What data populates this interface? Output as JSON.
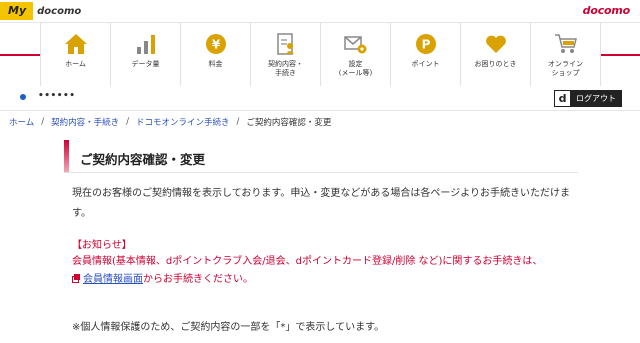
{
  "header": {
    "my_label": "My",
    "my_brand": "docomo",
    "brand": "docomo"
  },
  "nav": {
    "items": [
      {
        "label": "ホーム",
        "icon": "home-icon"
      },
      {
        "label": "データ量",
        "icon": "bar-chart-icon"
      },
      {
        "label": "料金",
        "icon": "yen-icon"
      },
      {
        "label": "契約内容・\n手続き",
        "icon": "contract-document-icon"
      },
      {
        "label": "設定\n(メール等)",
        "icon": "mail-settings-icon"
      },
      {
        "label": "ポイント",
        "icon": "point-icon"
      },
      {
        "label": "お困りのとき",
        "icon": "heart-icon"
      },
      {
        "label": "オンライン\nショップ",
        "icon": "cart-icon"
      }
    ]
  },
  "user": {
    "id_masked": "••••••",
    "logout_d": "d",
    "logout_label": "ログアウト"
  },
  "breadcrumb": {
    "items": [
      "ホーム",
      "契約内容・手続き",
      "ドコモオンライン手続き"
    ],
    "current": "ご契約内容確認・変更",
    "separator": "/"
  },
  "page": {
    "title": "ご契約内容確認・変更",
    "intro": "現在のお客様のご契約情報を表示しております。申込・変更などがある場合は各ページよりお手続きいただけます。",
    "notice_heading": "【お知らせ】",
    "notice_body": "会員情報(基本情報、dポイントクラブ入会/退会、dポイントカード登録/削除 など)に関するお手続きは、",
    "member_link": "会員情報画面",
    "member_link_suffix": "からお手続きください。",
    "privacy_note": "※個人情報保護のため、ご契約内容の一部を「*」で表示しています。"
  },
  "colors": {
    "accent": "#cc0033",
    "icon_gold": "#d9a200",
    "link": "#2a4fbf",
    "my_yellow": "#f5c400"
  }
}
